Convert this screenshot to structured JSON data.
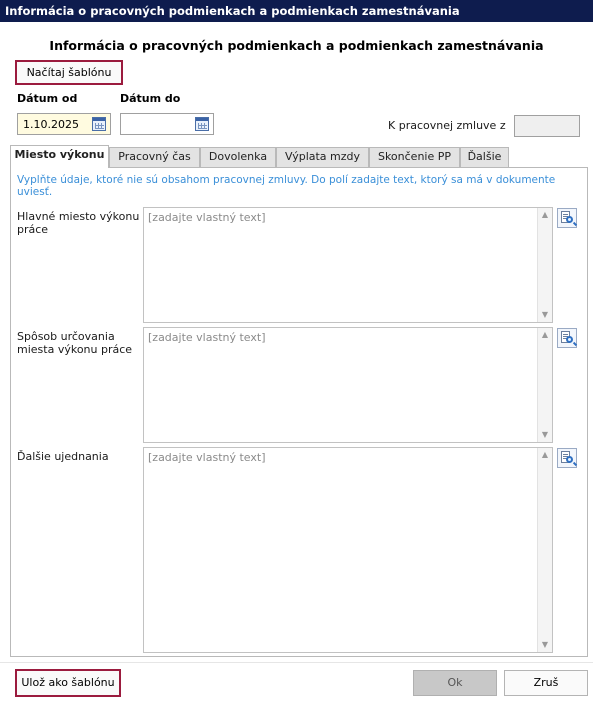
{
  "window": {
    "title": "Informácia o pracovných podmienkach a podmienkach zamestnávania"
  },
  "dialog": {
    "heading": "Informácia o pracovných podmienkach a podmienkach zamestnávania"
  },
  "toolbar": {
    "load_template_label": "Načítaj šablónu"
  },
  "dates": {
    "from_label": "Dátum od",
    "from_value": "1.10.2025",
    "to_label": "Dátum do",
    "to_value": "",
    "contract_label": "K pracovnej zmluve z",
    "contract_value": ""
  },
  "tabs": [
    {
      "label": "Miesto výkonu",
      "active": true
    },
    {
      "label": "Pracovný čas",
      "active": false
    },
    {
      "label": "Dovolenka",
      "active": false
    },
    {
      "label": "Výplata mzdy",
      "active": false
    },
    {
      "label": "Skončenie PP",
      "active": false
    },
    {
      "label": "Ďalšie",
      "active": false
    }
  ],
  "panel": {
    "hint": "Vyplňte údaje, ktoré nie sú obsahom pracovnej zmluvy. Do polí zadajte text, ktorý sa má v dokumente uviesť.",
    "fields": [
      {
        "label": "Hlavné miesto výkonu práce",
        "placeholder": "[zadajte vlastný text]",
        "value": ""
      },
      {
        "label": "Spôsob určovania miesta výkonu práce",
        "placeholder": "[zadajte vlastný text]",
        "value": ""
      },
      {
        "label": "Ďalšie ujednania",
        "placeholder": "[zadajte vlastný text]",
        "value": ""
      }
    ]
  },
  "footer": {
    "save_template_label": "Ulož ako šablónu",
    "ok_label": "Ok",
    "cancel_label": "Zruš"
  },
  "colors": {
    "titlebar": "#0e1c4e",
    "highlight_border": "#9b1b3e",
    "hint_text": "#3a8fd8",
    "date_filled_bg": "#fffbe0"
  },
  "icons": [
    "calendar-icon",
    "template-lookup-icon",
    "scroll-up-icon",
    "scroll-down-icon"
  ]
}
